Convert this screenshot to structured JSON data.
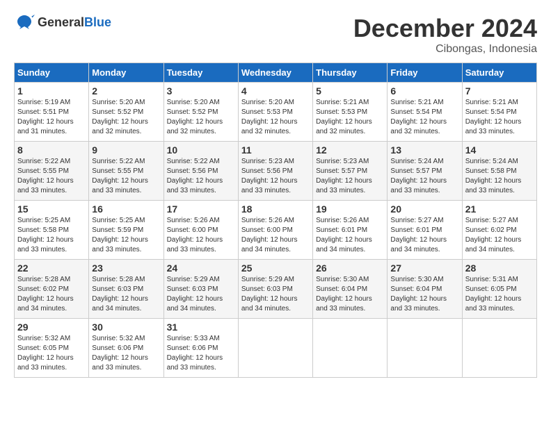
{
  "logo": {
    "general": "General",
    "blue": "Blue"
  },
  "header": {
    "title": "December 2024",
    "location": "Cibongas, Indonesia"
  },
  "days_of_week": [
    "Sunday",
    "Monday",
    "Tuesday",
    "Wednesday",
    "Thursday",
    "Friday",
    "Saturday"
  ],
  "weeks": [
    [
      {
        "day": "1",
        "sunrise": "5:19 AM",
        "sunset": "5:51 PM",
        "daylight": "12 hours and 31 minutes."
      },
      {
        "day": "2",
        "sunrise": "5:20 AM",
        "sunset": "5:52 PM",
        "daylight": "12 hours and 32 minutes."
      },
      {
        "day": "3",
        "sunrise": "5:20 AM",
        "sunset": "5:52 PM",
        "daylight": "12 hours and 32 minutes."
      },
      {
        "day": "4",
        "sunrise": "5:20 AM",
        "sunset": "5:53 PM",
        "daylight": "12 hours and 32 minutes."
      },
      {
        "day": "5",
        "sunrise": "5:21 AM",
        "sunset": "5:53 PM",
        "daylight": "12 hours and 32 minutes."
      },
      {
        "day": "6",
        "sunrise": "5:21 AM",
        "sunset": "5:54 PM",
        "daylight": "12 hours and 32 minutes."
      },
      {
        "day": "7",
        "sunrise": "5:21 AM",
        "sunset": "5:54 PM",
        "daylight": "12 hours and 33 minutes."
      }
    ],
    [
      {
        "day": "8",
        "sunrise": "5:22 AM",
        "sunset": "5:55 PM",
        "daylight": "12 hours and 33 minutes."
      },
      {
        "day": "9",
        "sunrise": "5:22 AM",
        "sunset": "5:55 PM",
        "daylight": "12 hours and 33 minutes."
      },
      {
        "day": "10",
        "sunrise": "5:22 AM",
        "sunset": "5:56 PM",
        "daylight": "12 hours and 33 minutes."
      },
      {
        "day": "11",
        "sunrise": "5:23 AM",
        "sunset": "5:56 PM",
        "daylight": "12 hours and 33 minutes."
      },
      {
        "day": "12",
        "sunrise": "5:23 AM",
        "sunset": "5:57 PM",
        "daylight": "12 hours and 33 minutes."
      },
      {
        "day": "13",
        "sunrise": "5:24 AM",
        "sunset": "5:57 PM",
        "daylight": "12 hours and 33 minutes."
      },
      {
        "day": "14",
        "sunrise": "5:24 AM",
        "sunset": "5:58 PM",
        "daylight": "12 hours and 33 minutes."
      }
    ],
    [
      {
        "day": "15",
        "sunrise": "5:25 AM",
        "sunset": "5:58 PM",
        "daylight": "12 hours and 33 minutes."
      },
      {
        "day": "16",
        "sunrise": "5:25 AM",
        "sunset": "5:59 PM",
        "daylight": "12 hours and 33 minutes."
      },
      {
        "day": "17",
        "sunrise": "5:26 AM",
        "sunset": "6:00 PM",
        "daylight": "12 hours and 33 minutes."
      },
      {
        "day": "18",
        "sunrise": "5:26 AM",
        "sunset": "6:00 PM",
        "daylight": "12 hours and 34 minutes."
      },
      {
        "day": "19",
        "sunrise": "5:26 AM",
        "sunset": "6:01 PM",
        "daylight": "12 hours and 34 minutes."
      },
      {
        "day": "20",
        "sunrise": "5:27 AM",
        "sunset": "6:01 PM",
        "daylight": "12 hours and 34 minutes."
      },
      {
        "day": "21",
        "sunrise": "5:27 AM",
        "sunset": "6:02 PM",
        "daylight": "12 hours and 34 minutes."
      }
    ],
    [
      {
        "day": "22",
        "sunrise": "5:28 AM",
        "sunset": "6:02 PM",
        "daylight": "12 hours and 34 minutes."
      },
      {
        "day": "23",
        "sunrise": "5:28 AM",
        "sunset": "6:03 PM",
        "daylight": "12 hours and 34 minutes."
      },
      {
        "day": "24",
        "sunrise": "5:29 AM",
        "sunset": "6:03 PM",
        "daylight": "12 hours and 34 minutes."
      },
      {
        "day": "25",
        "sunrise": "5:29 AM",
        "sunset": "6:03 PM",
        "daylight": "12 hours and 34 minutes."
      },
      {
        "day": "26",
        "sunrise": "5:30 AM",
        "sunset": "6:04 PM",
        "daylight": "12 hours and 33 minutes."
      },
      {
        "day": "27",
        "sunrise": "5:30 AM",
        "sunset": "6:04 PM",
        "daylight": "12 hours and 33 minutes."
      },
      {
        "day": "28",
        "sunrise": "5:31 AM",
        "sunset": "6:05 PM",
        "daylight": "12 hours and 33 minutes."
      }
    ],
    [
      {
        "day": "29",
        "sunrise": "5:32 AM",
        "sunset": "6:05 PM",
        "daylight": "12 hours and 33 minutes."
      },
      {
        "day": "30",
        "sunrise": "5:32 AM",
        "sunset": "6:06 PM",
        "daylight": "12 hours and 33 minutes."
      },
      {
        "day": "31",
        "sunrise": "5:33 AM",
        "sunset": "6:06 PM",
        "daylight": "12 hours and 33 minutes."
      },
      null,
      null,
      null,
      null
    ]
  ]
}
